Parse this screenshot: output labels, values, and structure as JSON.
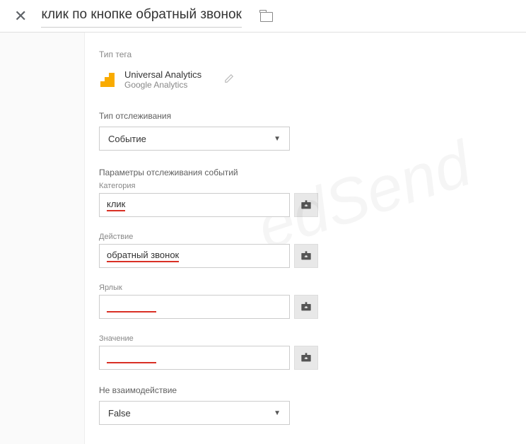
{
  "header": {
    "title": "клик по кнопке обратный звонок"
  },
  "tagType": {
    "sectionLabel": "Тип тега",
    "name": "Universal Analytics",
    "sub": "Google Analytics"
  },
  "tracking": {
    "label": "Тип отслеживания",
    "selected": "Событие"
  },
  "eventParams": {
    "sectionLabel": "Параметры отслеживания событий",
    "category": {
      "label": "Категория",
      "value": "клик"
    },
    "action": {
      "label": "Действие",
      "value": "обратный звонок"
    },
    "ticket": {
      "label": "Ярлык",
      "value": ""
    },
    "value": {
      "label": "Значение",
      "value": ""
    }
  },
  "noInteraction": {
    "label": "Не взаимодействие",
    "selected": "False"
  }
}
